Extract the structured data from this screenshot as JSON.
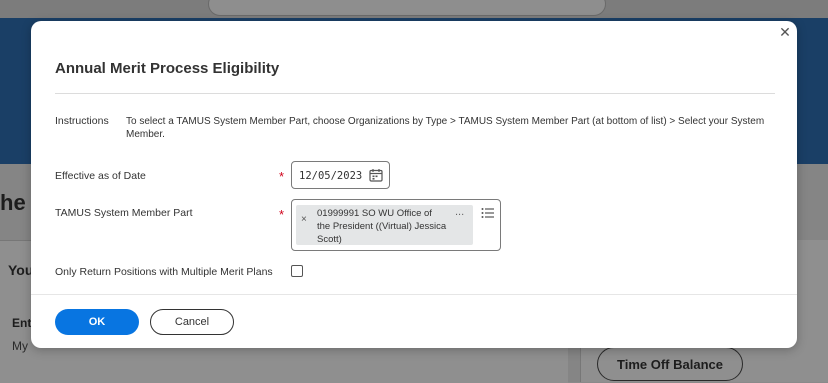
{
  "background": {
    "heading_fragment": "he",
    "card_heading_fragment": "You",
    "card_item_fragment": "Ent",
    "card_sub_fragment": "My",
    "time_off_button": "Time Off Balance"
  },
  "dialog": {
    "title": "Annual Merit Process Eligibility",
    "close_icon": "close-icon",
    "instructions": {
      "label": "Instructions",
      "text": "To select a TAMUS System Member Part, choose Organizations by Type > TAMUS System Member Part (at bottom of list) > Select your System Member."
    },
    "effective_date": {
      "label": "Effective as of Date",
      "required_marker": "*",
      "value": "12/05/2023",
      "icon": "calendar-icon"
    },
    "member_part": {
      "label": "TAMUS System Member Part",
      "required_marker": "*",
      "selected": "01999991 SO WU Office of the President ((Virtual) Jessica Scott)",
      "more_label": "...",
      "remove_label": "×",
      "icon": "list-icon"
    },
    "multi_merit": {
      "label": "Only Return Positions with Multiple Merit Plans",
      "checked": false
    },
    "buttons": {
      "ok": "OK",
      "cancel": "Cancel"
    }
  },
  "colors": {
    "accent": "#0875e1",
    "required": "#d0021b",
    "banner": "#1a3f66"
  }
}
